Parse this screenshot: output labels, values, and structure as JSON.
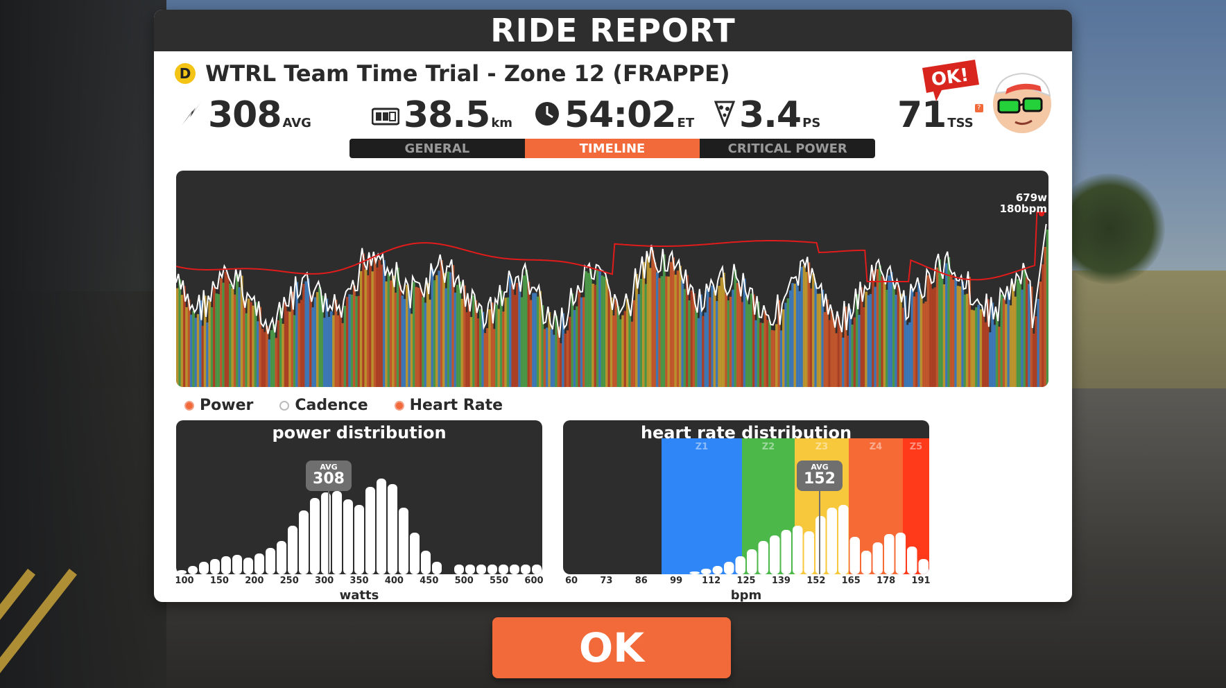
{
  "header": {
    "title": "RIDE REPORT"
  },
  "event": {
    "category": "D",
    "name": "WTRL Team Time Trial - Zone 12 (FRAPPE)"
  },
  "stats": {
    "power": {
      "value": "308",
      "unit": "AVG"
    },
    "distance": {
      "value": "38.5",
      "unit": "km"
    },
    "time": {
      "value": "54:02",
      "unit": "ET"
    },
    "pizza": {
      "value": "3.4",
      "unit": "PS"
    },
    "tss": {
      "value": "71",
      "unit": "TSS"
    }
  },
  "mascot": {
    "speech": "OK!"
  },
  "tabs": [
    {
      "label": "GENERAL",
      "active": false
    },
    {
      "label": "TIMELINE",
      "active": true
    },
    {
      "label": "CRITICAL POWER",
      "active": false
    }
  ],
  "timeline": {
    "peak_power": "679w",
    "peak_hr": "180bpm"
  },
  "legend": [
    {
      "label": "Power",
      "checked": true
    },
    {
      "label": "Cadence",
      "checked": false
    },
    {
      "label": "Heart Rate",
      "checked": true
    }
  ],
  "power_distribution": {
    "title": "power distribution",
    "avg_label": "AVG",
    "avg_value": "308",
    "xlabel": "watts",
    "ticks": [
      "100",
      "150",
      "200",
      "250",
      "300",
      "350",
      "400",
      "450",
      "500",
      "550",
      "600"
    ]
  },
  "hr_distribution": {
    "title": "heart rate distribution",
    "avg_label": "AVG",
    "avg_value": "152",
    "xlabel": "bpm",
    "ticks": [
      "60",
      "73",
      "86",
      "99",
      "112",
      "125",
      "139",
      "152",
      "165",
      "178",
      "191"
    ],
    "zones": [
      {
        "label": "Z1",
        "color": "#2f86f6"
      },
      {
        "label": "Z2",
        "color": "#4cb84a"
      },
      {
        "label": "Z3",
        "color": "#f7c73c"
      },
      {
        "label": "Z4",
        "color": "#f66a35"
      },
      {
        "label": "Z5",
        "color": "#ff3a1a"
      }
    ]
  },
  "ok_button": {
    "label": "OK"
  },
  "colors": {
    "accent": "#f26a3a",
    "panel_dark": "#2d2d2d",
    "hr_line": "#e21b1b"
  }
}
